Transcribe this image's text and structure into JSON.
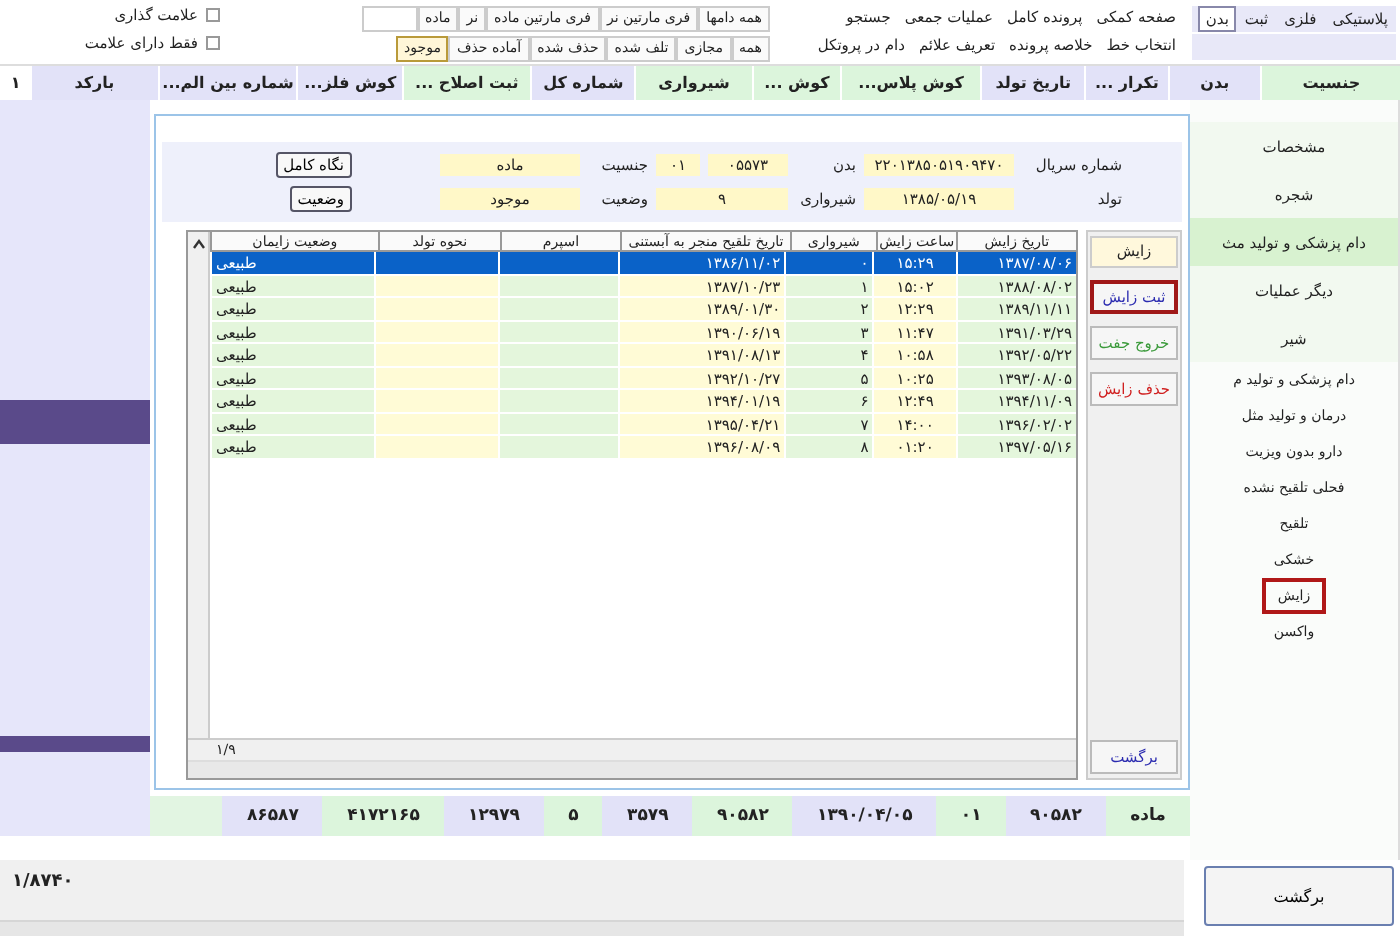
{
  "type_tabs": [
    {
      "label": "پلاستیکی",
      "selected": false
    },
    {
      "label": "فلزی",
      "selected": false
    },
    {
      "label": "ثبت",
      "selected": false
    },
    {
      "label": "بدن",
      "selected": true
    }
  ],
  "menu_rows": [
    [
      "صفحه کمکی",
      "پرونده کامل",
      "عملیات جمعی",
      "جستجو"
    ],
    [
      "انتخاب خط",
      "خلاصه پرونده",
      "تعریف علائم",
      "دام در پروتکل"
    ]
  ],
  "sex_filters": [
    {
      "label": "همه دامها",
      "selected": false
    },
    {
      "label": "فری مارتین نر",
      "selected": false
    },
    {
      "label": "فری مارتین ماده",
      "selected": false
    },
    {
      "label": "نر",
      "selected": false
    },
    {
      "label": "ماده",
      "selected": false
    }
  ],
  "status_filters": [
    {
      "label": "همه",
      "selected": false
    },
    {
      "label": "مجازی",
      "selected": false
    },
    {
      "label": "تلف شده",
      "selected": false
    },
    {
      "label": "حذف شده",
      "selected": false
    },
    {
      "label": "آماده حذف",
      "selected": false
    },
    {
      "label": "موجود",
      "selected": true
    }
  ],
  "mark_options": [
    {
      "label": "علامت گذاری",
      "checked": false
    },
    {
      "label": "فقط دارای علامت",
      "checked": false
    }
  ],
  "grid_columns": [
    {
      "label": "جنسیت",
      "color": "#dcf5dc"
    },
    {
      "label": "بدن",
      "color": "#e2e2f8"
    },
    {
      "label": "تکرار ...",
      "color": "#e2e2f8"
    },
    {
      "label": "تاریخ تولد",
      "color": "#e2e2f8"
    },
    {
      "label": "کوش پلاس...",
      "color": "#dcf5dc"
    },
    {
      "label": "کوش ...",
      "color": "#dcf5dc"
    },
    {
      "label": "شیرواری",
      "color": "#dcf5dc"
    },
    {
      "label": "شماره کل",
      "color": "#e2e2f8"
    },
    {
      "label": "ثبت اصلاح ...",
      "color": "#dcf5dc"
    },
    {
      "label": "کوش فلز...",
      "color": "#e2e2f8"
    },
    {
      "label": "شماره بین الم...",
      "color": "#e2e2f8"
    },
    {
      "label": "بارکد",
      "color": "#e2e2f8"
    },
    {
      "label": "۱",
      "color": "#ffffff"
    }
  ],
  "sidebar": [
    {
      "label": "مشخصات",
      "kind": "tab",
      "selected": false
    },
    {
      "label": "شجره",
      "kind": "tab",
      "selected": false
    },
    {
      "label": "دام پزشکی و تولید مث",
      "kind": "tab",
      "selected": true
    },
    {
      "label": "دیگر عملیات",
      "kind": "tab",
      "selected": false
    },
    {
      "label": "شیر",
      "kind": "tab",
      "selected": false
    },
    {
      "label": "دام پزشکی و تولید م",
      "kind": "section",
      "selected": false
    },
    {
      "label": "درمان و تولید مثل",
      "kind": "item",
      "selected": false
    },
    {
      "label": "دارو بدون ویزیت",
      "kind": "item",
      "selected": false
    },
    {
      "label": "فحلی تلقیح نشده",
      "kind": "item",
      "selected": false
    },
    {
      "label": "تلقیح",
      "kind": "item",
      "selected": false
    },
    {
      "label": "خشکی",
      "kind": "item",
      "selected": false
    },
    {
      "label": "زایش",
      "kind": "item",
      "selected": true
    },
    {
      "label": "واکسن",
      "kind": "item",
      "selected": false
    }
  ],
  "dialog": {
    "info_rows": [
      {
        "fields": [
          {
            "label": "شماره سریال",
            "value": "۲۲۰۱۳۸۵۰۵۱۹۰۹۴۷۰"
          },
          {
            "label": "بدن",
            "value": "۰۵۵۷۳"
          },
          {
            "value": "۰۱"
          },
          {
            "label": "جنسیت",
            "value": "ماده"
          }
        ],
        "button": "نگاه کامل"
      },
      {
        "fields": [
          {
            "label": "تولد",
            "value": "۱۳۸۵/۰۵/۱۹"
          },
          {
            "label": "شیرواری",
            "value": "۹"
          },
          {
            "label": "وضعیت",
            "value": "موجود"
          }
        ],
        "button": "وضعیت"
      }
    ],
    "columns": [
      "تاریخ زایش",
      "ساعت زایش",
      "شیرواری",
      "تاریخ تلقیح منجر به آبستنی",
      "اسپرم",
      "نحوه تولد",
      "وضعیت زایمان"
    ],
    "rows": [
      {
        "cells": [
          "۱۳۸۷/۰۸/۰۶",
          "۱۵:۲۹",
          "۰",
          "۱۳۸۶/۱۱/۰۲",
          "",
          "",
          "طبیعی"
        ],
        "selected": true
      },
      {
        "cells": [
          "۱۳۸۸/۰۸/۰۲",
          "۱۵:۰۲",
          "۱",
          "۱۳۸۷/۱۰/۲۳",
          "",
          "",
          "طبیعی"
        ],
        "selected": false
      },
      {
        "cells": [
          "۱۳۸۹/۱۱/۱۱",
          "۱۲:۲۹",
          "۲",
          "۱۳۸۹/۰۱/۳۰",
          "",
          "",
          "طبیعی"
        ],
        "selected": false
      },
      {
        "cells": [
          "۱۳۹۱/۰۳/۲۹",
          "۱۱:۴۷",
          "۳",
          "۱۳۹۰/۰۶/۱۹",
          "",
          "",
          "طبیعی"
        ],
        "selected": false
      },
      {
        "cells": [
          "۱۳۹۲/۰۵/۲۲",
          "۱۰:۵۸",
          "۴",
          "۱۳۹۱/۰۸/۱۳",
          "",
          "",
          "طبیعی"
        ],
        "selected": false
      },
      {
        "cells": [
          "۱۳۹۳/۰۸/۰۵",
          "۱۰:۲۵",
          "۵",
          "۱۳۹۲/۱۰/۲۷",
          "",
          "",
          "طبیعی"
        ],
        "selected": false
      },
      {
        "cells": [
          "۱۳۹۴/۱۱/۰۹",
          "۱۲:۴۹",
          "۶",
          "۱۳۹۴/۰۱/۱۹",
          "",
          "",
          "طبیعی"
        ],
        "selected": false
      },
      {
        "cells": [
          "۱۳۹۶/۰۲/۰۲",
          "۱۴:۰۰",
          "۷",
          "۱۳۹۵/۰۴/۲۱",
          "",
          "",
          "طبیعی"
        ],
        "selected": false
      },
      {
        "cells": [
          "۱۳۹۷/۰۵/۱۶",
          "۰۱:۲۰",
          "۸",
          "۱۳۹۶/۰۸/۰۹",
          "",
          "",
          "طبیعی"
        ],
        "selected": false
      }
    ],
    "record_counter": "۱/۹",
    "side_title": "زایش",
    "side_buttons": [
      {
        "label": "ثبت زایش",
        "color": "#2b2bb0",
        "focused": true
      },
      {
        "label": "خروج جفت",
        "color": "#3a9a3a",
        "focused": false
      },
      {
        "label": "حذف زایش",
        "color": "#d02020",
        "focused": false
      }
    ],
    "back_button": "برگشت"
  },
  "summary": [
    {
      "text": "ماده",
      "color": "#dcf5dc"
    },
    {
      "text": "۹۰۵۸۲",
      "color": "#e2e2f8"
    },
    {
      "text": "۰۱",
      "color": "#dcf5dc"
    },
    {
      "text": "۱۳۹۰/۰۴/۰۵",
      "color": "#e2e2f8"
    },
    {
      "text": "۹۰۵۸۲",
      "color": "#dcf5dc"
    },
    {
      "text": "۳۵۷۹",
      "color": "#e2e2f8"
    },
    {
      "text": "۵",
      "color": "#dcf5dc"
    },
    {
      "text": "۱۲۹۷۹",
      "color": "#e2e2f8"
    },
    {
      "text": "۴۱۷۲۱۶۵",
      "color": "#dcf5dc"
    },
    {
      "text": "۸۶۵۸۷",
      "color": "#e2e2f8"
    }
  ],
  "record_counter": "۱/۸۷۴۰",
  "back_button": "برگشت"
}
